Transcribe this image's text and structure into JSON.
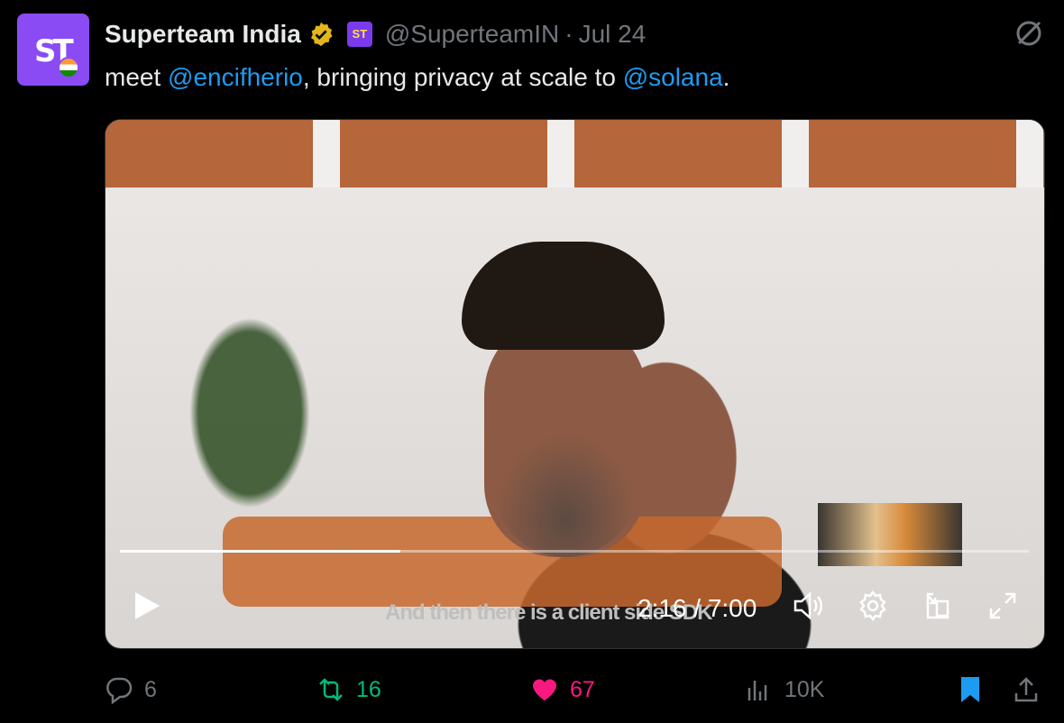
{
  "tweet": {
    "author_name": "Superteam India",
    "affiliate_badge": "ST",
    "handle": "@SuperteamIN",
    "separator": "·",
    "date": "Jul 24",
    "text_before": "meet ",
    "mention_1": "@encifherio",
    "text_middle": ", bringing privacy at scale to ",
    "mention_2": "@solana",
    "text_after": "."
  },
  "avatar": {
    "logo_text": "ST"
  },
  "video": {
    "progress_fraction": 0.309,
    "time": "2:16 / 7:00",
    "subtitle": "And then there is a client side SDK"
  },
  "actions": {
    "replies": "6",
    "reposts": "16",
    "likes": "67",
    "views": "10K"
  },
  "colors": {
    "accent": "#1d9bf0",
    "repost": "#00ba7c",
    "like": "#f91880",
    "muted": "#71767b",
    "avatar_bg": "#8a4bf5"
  },
  "icons": [
    "verified-badge-icon",
    "grok-icon",
    "play-icon",
    "volume-icon",
    "settings-icon",
    "pip-icon",
    "fullscreen-icon",
    "reply-icon",
    "repost-icon",
    "heart-icon",
    "views-icon",
    "bookmark-icon",
    "share-icon"
  ]
}
